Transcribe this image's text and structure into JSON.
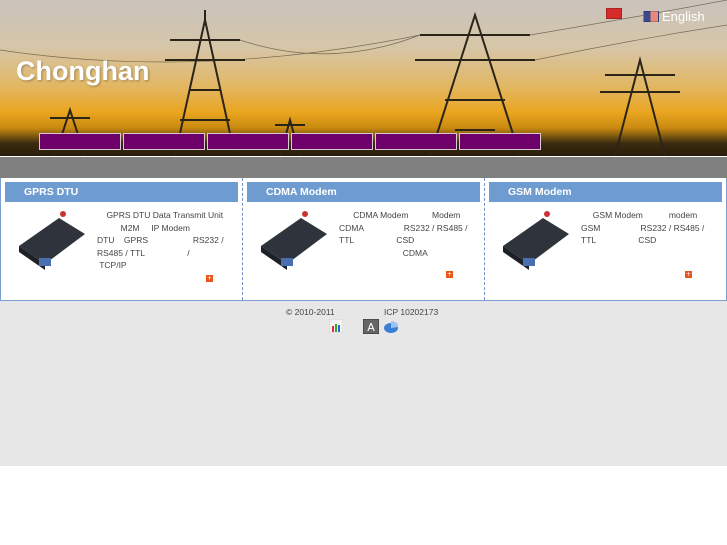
{
  "header": {
    "logo": "Chonghan",
    "lang_english": "English",
    "lang_chinese_flag": "cn-flag-icon",
    "lang_english_flag": "us-flag-icon"
  },
  "nav": {
    "items": [
      "",
      "",
      "",
      "",
      "",
      ""
    ],
    "color": "#6e006a"
  },
  "products": [
    {
      "title": "GPRS DTU",
      "desc": "    GPRS DTU Data Transmit Unit\n          M2M     IP Modem\nDTU    GPRS                   RS232 /\nRS485 / TTL                  /\n TCP/IP"
    },
    {
      "title": "CDMA Modem",
      "desc": "      CDMA Modem          Modem\nCDMA                 RS232 / RS485 /\nTTL                  CSD\n                           CDMA"
    },
    {
      "title": "GSM Modem",
      "desc": "     GSM Modem           modem\nGSM                 RS232 / RS485 /\nTTL                  CSD"
    }
  ],
  "footer": {
    "copyright": "© 2010-2011",
    "icp": "ICP 10202173"
  }
}
